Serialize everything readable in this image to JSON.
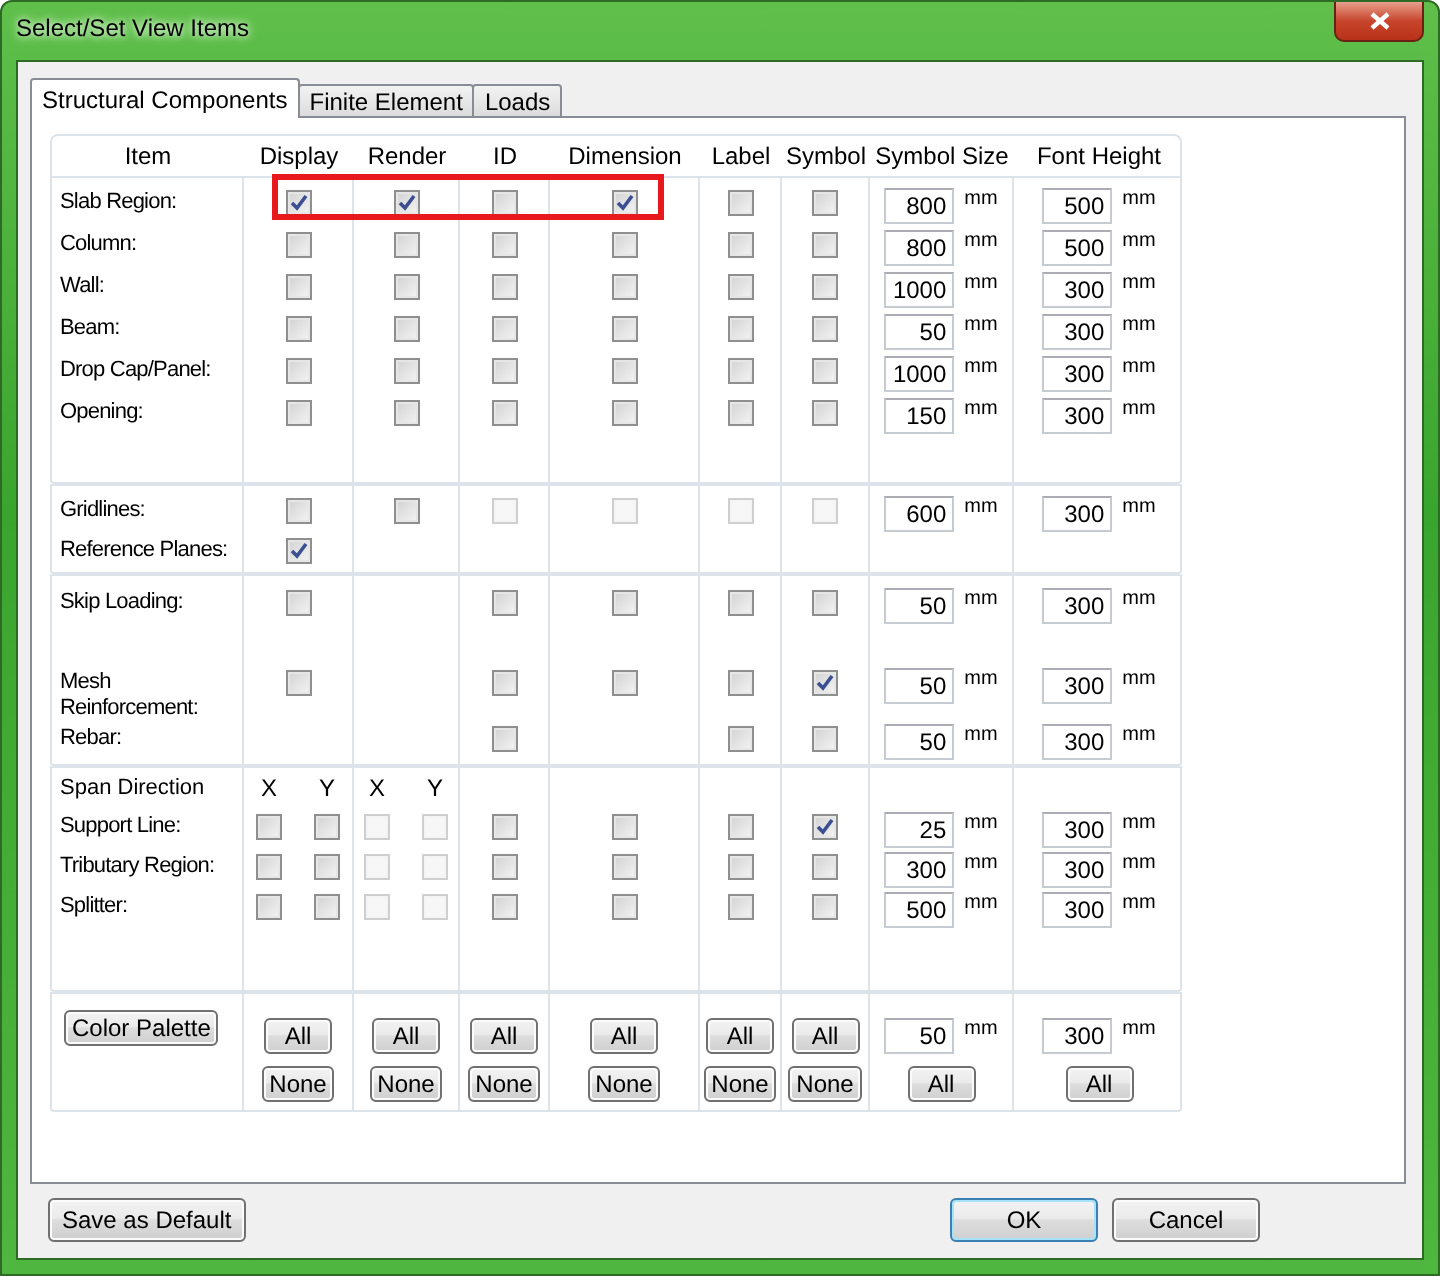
{
  "window": {
    "title": "Select/Set View Items"
  },
  "tabs": [
    {
      "label": "Structural Components",
      "selected": true
    },
    {
      "label": "Finite Element",
      "selected": false
    },
    {
      "label": "Loads",
      "selected": false
    }
  ],
  "columns": [
    "Item",
    "Display",
    "Render",
    "ID",
    "Dimension",
    "Label",
    "Symbol",
    "Symbol Size",
    "Font Height"
  ],
  "sections": [
    {
      "rows": [
        {
          "kind": "item",
          "label": "Slab Region:",
          "highlighted": true,
          "cells": [
            {
              "kind": "checkbox",
              "checked": true,
              "disabled": false
            },
            {
              "kind": "checkbox",
              "checked": true,
              "disabled": false
            },
            {
              "kind": "checkbox",
              "checked": false,
              "disabled": false
            },
            {
              "kind": "checkbox",
              "checked": true,
              "disabled": false
            },
            {
              "kind": "checkbox",
              "checked": false,
              "disabled": false
            },
            {
              "kind": "checkbox",
              "checked": false,
              "disabled": false
            }
          ],
          "symbol_size": {
            "value": "800",
            "unit": "mm"
          },
          "font_height": {
            "value": "500",
            "unit": "mm"
          }
        },
        {
          "kind": "item",
          "label": "Column:",
          "cells": [
            {
              "kind": "checkbox",
              "checked": false,
              "disabled": false
            },
            {
              "kind": "checkbox",
              "checked": false,
              "disabled": false
            },
            {
              "kind": "checkbox",
              "checked": false,
              "disabled": false
            },
            {
              "kind": "checkbox",
              "checked": false,
              "disabled": false
            },
            {
              "kind": "checkbox",
              "checked": false,
              "disabled": false
            },
            {
              "kind": "checkbox",
              "checked": false,
              "disabled": false
            }
          ],
          "symbol_size": {
            "value": "800",
            "unit": "mm"
          },
          "font_height": {
            "value": "500",
            "unit": "mm"
          }
        },
        {
          "kind": "item",
          "label": "Wall:",
          "cells": [
            {
              "kind": "checkbox",
              "checked": false,
              "disabled": false
            },
            {
              "kind": "checkbox",
              "checked": false,
              "disabled": false
            },
            {
              "kind": "checkbox",
              "checked": false,
              "disabled": false
            },
            {
              "kind": "checkbox",
              "checked": false,
              "disabled": false
            },
            {
              "kind": "checkbox",
              "checked": false,
              "disabled": false
            },
            {
              "kind": "checkbox",
              "checked": false,
              "disabled": false
            }
          ],
          "symbol_size": {
            "value": "1000",
            "unit": "mm"
          },
          "font_height": {
            "value": "300",
            "unit": "mm"
          }
        },
        {
          "kind": "item",
          "label": "Beam:",
          "cells": [
            {
              "kind": "checkbox",
              "checked": false,
              "disabled": false
            },
            {
              "kind": "checkbox",
              "checked": false,
              "disabled": false
            },
            {
              "kind": "checkbox",
              "checked": false,
              "disabled": false
            },
            {
              "kind": "checkbox",
              "checked": false,
              "disabled": false
            },
            {
              "kind": "checkbox",
              "checked": false,
              "disabled": false
            },
            {
              "kind": "checkbox",
              "checked": false,
              "disabled": false
            }
          ],
          "symbol_size": {
            "value": "50",
            "unit": "mm"
          },
          "font_height": {
            "value": "300",
            "unit": "mm"
          }
        },
        {
          "kind": "item",
          "label": "Drop Cap/Panel:",
          "cells": [
            {
              "kind": "checkbox",
              "checked": false,
              "disabled": false
            },
            {
              "kind": "checkbox",
              "checked": false,
              "disabled": false
            },
            {
              "kind": "checkbox",
              "checked": false,
              "disabled": false
            },
            {
              "kind": "checkbox",
              "checked": false,
              "disabled": false
            },
            {
              "kind": "checkbox",
              "checked": false,
              "disabled": false
            },
            {
              "kind": "checkbox",
              "checked": false,
              "disabled": false
            }
          ],
          "symbol_size": {
            "value": "1000",
            "unit": "mm"
          },
          "font_height": {
            "value": "300",
            "unit": "mm"
          }
        },
        {
          "kind": "item",
          "label": "Opening:",
          "cells": [
            {
              "kind": "checkbox",
              "checked": false,
              "disabled": false
            },
            {
              "kind": "checkbox",
              "checked": false,
              "disabled": false
            },
            {
              "kind": "checkbox",
              "checked": false,
              "disabled": false
            },
            {
              "kind": "checkbox",
              "checked": false,
              "disabled": false
            },
            {
              "kind": "checkbox",
              "checked": false,
              "disabled": false
            },
            {
              "kind": "checkbox",
              "checked": false,
              "disabled": false
            }
          ],
          "symbol_size": {
            "value": "150",
            "unit": "mm"
          },
          "font_height": {
            "value": "300",
            "unit": "mm"
          }
        }
      ]
    },
    {
      "rows": [
        {
          "kind": "item",
          "label": "Gridlines:",
          "cells": [
            {
              "kind": "checkbox",
              "checked": false,
              "disabled": false
            },
            {
              "kind": "checkbox",
              "checked": false,
              "disabled": false
            },
            {
              "kind": "checkbox",
              "checked": false,
              "disabled": true
            },
            {
              "kind": "checkbox",
              "checked": false,
              "disabled": true
            },
            {
              "kind": "checkbox",
              "checked": false,
              "disabled": true
            },
            {
              "kind": "checkbox",
              "checked": false,
              "disabled": true
            }
          ],
          "symbol_size": {
            "value": "600",
            "unit": "mm"
          },
          "font_height": {
            "value": "300",
            "unit": "mm"
          }
        },
        {
          "kind": "item",
          "label": "Reference Planes:",
          "cells": [
            {
              "kind": "checkbox",
              "checked": true,
              "disabled": false
            },
            {
              "kind": "empty"
            },
            {
              "kind": "empty"
            },
            {
              "kind": "empty"
            },
            {
              "kind": "empty"
            },
            {
              "kind": "empty"
            }
          ]
        }
      ]
    },
    {
      "rows": [
        {
          "kind": "item",
          "label": "Skip Loading:",
          "cells": [
            {
              "kind": "checkbox",
              "checked": false,
              "disabled": false
            },
            {
              "kind": "empty"
            },
            {
              "kind": "checkbox",
              "checked": false,
              "disabled": false
            },
            {
              "kind": "checkbox",
              "checked": false,
              "disabled": false
            },
            {
              "kind": "checkbox",
              "checked": false,
              "disabled": false
            },
            {
              "kind": "checkbox",
              "checked": false,
              "disabled": false
            }
          ],
          "symbol_size": {
            "value": "50",
            "unit": "mm"
          },
          "font_height": {
            "value": "300",
            "unit": "mm"
          }
        },
        {
          "kind": "item",
          "label": "Mesh Reinforcement:",
          "cells": [
            {
              "kind": "checkbox",
              "checked": false,
              "disabled": false
            },
            {
              "kind": "empty"
            },
            {
              "kind": "checkbox",
              "checked": false,
              "disabled": false
            },
            {
              "kind": "checkbox",
              "checked": false,
              "disabled": false
            },
            {
              "kind": "checkbox",
              "checked": false,
              "disabled": false
            },
            {
              "kind": "checkbox",
              "checked": true,
              "disabled": false
            }
          ],
          "symbol_size": {
            "value": "50",
            "unit": "mm"
          },
          "font_height": {
            "value": "300",
            "unit": "mm"
          }
        },
        {
          "kind": "item",
          "label": "Rebar:",
          "cells": [
            {
              "kind": "empty"
            },
            {
              "kind": "empty"
            },
            {
              "kind": "checkbox",
              "checked": false,
              "disabled": false
            },
            {
              "kind": "empty"
            },
            {
              "kind": "checkbox",
              "checked": false,
              "disabled": false
            },
            {
              "kind": "checkbox",
              "checked": false,
              "disabled": false
            }
          ],
          "symbol_size": {
            "value": "50",
            "unit": "mm"
          },
          "font_height": {
            "value": "300",
            "unit": "mm"
          }
        }
      ]
    },
    {
      "rows": [
        {
          "kind": "subheader",
          "label": "Span Direction",
          "cells": [
            {
              "kind": "labels",
              "items": [
                "X",
                "Y"
              ]
            },
            {
              "kind": "labels",
              "items": [
                "X",
                "Y"
              ]
            },
            {
              "kind": "empty"
            },
            {
              "kind": "empty"
            },
            {
              "kind": "empty"
            },
            {
              "kind": "empty"
            }
          ]
        },
        {
          "kind": "item",
          "label": "Support Line:",
          "cells": [
            {
              "kind": "pair",
              "items": [
                {
                  "checked": false,
                  "disabled": false
                },
                {
                  "checked": false,
                  "disabled": false
                }
              ]
            },
            {
              "kind": "pair",
              "items": [
                {
                  "checked": false,
                  "disabled": true
                },
                {
                  "checked": false,
                  "disabled": true
                }
              ]
            },
            {
              "kind": "checkbox",
              "checked": false,
              "disabled": false
            },
            {
              "kind": "checkbox",
              "checked": false,
              "disabled": false
            },
            {
              "kind": "checkbox",
              "checked": false,
              "disabled": false
            },
            {
              "kind": "checkbox",
              "checked": true,
              "disabled": false
            }
          ],
          "symbol_size": {
            "value": "25",
            "unit": "mm"
          },
          "font_height": {
            "value": "300",
            "unit": "mm"
          }
        },
        {
          "kind": "item",
          "label": "Tributary Region:",
          "cells": [
            {
              "kind": "pair",
              "items": [
                {
                  "checked": false,
                  "disabled": false
                },
                {
                  "checked": false,
                  "disabled": false
                }
              ]
            },
            {
              "kind": "pair",
              "items": [
                {
                  "checked": false,
                  "disabled": true
                },
                {
                  "checked": false,
                  "disabled": true
                }
              ]
            },
            {
              "kind": "checkbox",
              "checked": false,
              "disabled": false
            },
            {
              "kind": "checkbox",
              "checked": false,
              "disabled": false
            },
            {
              "kind": "checkbox",
              "checked": false,
              "disabled": false
            },
            {
              "kind": "checkbox",
              "checked": false,
              "disabled": false
            }
          ],
          "symbol_size": {
            "value": "300",
            "unit": "mm"
          },
          "font_height": {
            "value": "300",
            "unit": "mm"
          }
        },
        {
          "kind": "item",
          "label": "Splitter:",
          "cells": [
            {
              "kind": "pair",
              "items": [
                {
                  "checked": false,
                  "disabled": false
                },
                {
                  "checked": false,
                  "disabled": false
                }
              ]
            },
            {
              "kind": "pair",
              "items": [
                {
                  "checked": false,
                  "disabled": true
                },
                {
                  "checked": false,
                  "disabled": true
                }
              ]
            },
            {
              "kind": "checkbox",
              "checked": false,
              "disabled": false
            },
            {
              "kind": "checkbox",
              "checked": false,
              "disabled": false
            },
            {
              "kind": "checkbox",
              "checked": false,
              "disabled": false
            },
            {
              "kind": "checkbox",
              "checked": false,
              "disabled": false
            }
          ],
          "symbol_size": {
            "value": "500",
            "unit": "mm"
          },
          "font_height": {
            "value": "300",
            "unit": "mm"
          }
        }
      ]
    }
  ],
  "footer": {
    "palette_button": "Color Palette",
    "column_buttons": [
      [
        "All",
        "None"
      ],
      [
        "All",
        "None"
      ],
      [
        "All",
        "None"
      ],
      [
        "All",
        "None"
      ],
      [
        "All",
        "None"
      ],
      [
        "All",
        "None"
      ]
    ],
    "symbol_size": {
      "value": "50",
      "unit": "mm",
      "button": "All"
    },
    "font_height": {
      "value": "300",
      "unit": "mm",
      "button": "All"
    }
  },
  "left_buttons": [
    {
      "label": "Save as Default",
      "default": false
    }
  ],
  "right_buttons": [
    {
      "label": "OK",
      "default": true
    },
    {
      "label": "Cancel",
      "default": false
    }
  ]
}
